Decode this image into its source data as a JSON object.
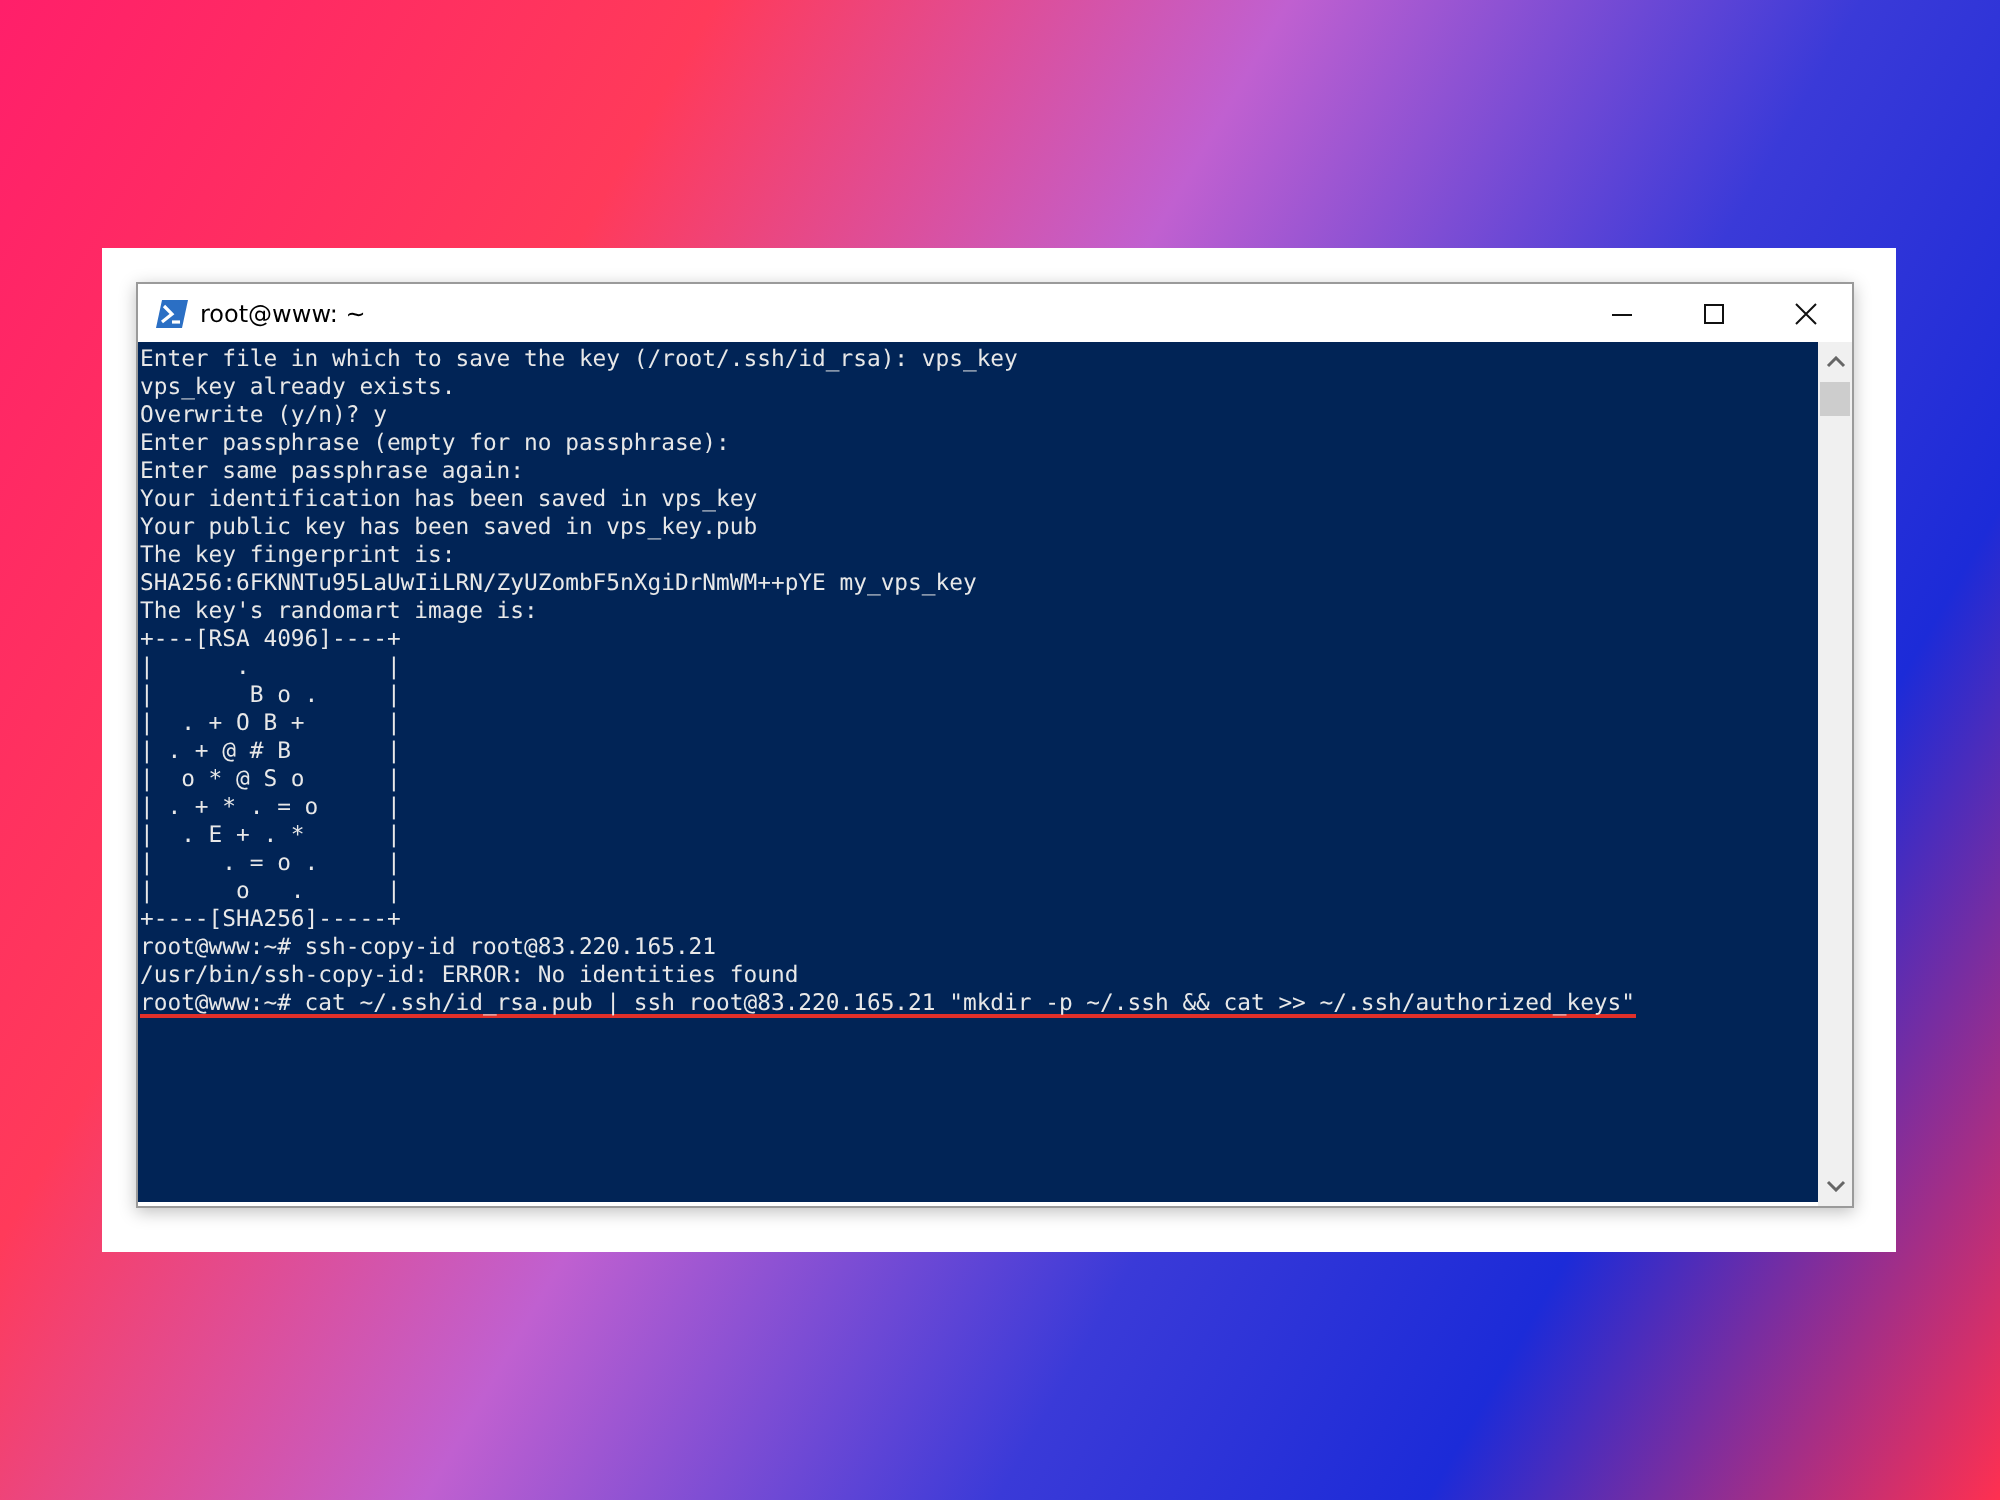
{
  "window": {
    "title": "root@www: ~"
  },
  "terminal": {
    "lines": [
      {
        "text": "Enter file in which to save the key (/root/.ssh/id_rsa): vps_key",
        "underlined": false
      },
      {
        "text": "vps_key already exists.",
        "underlined": false
      },
      {
        "text": "Overwrite (y/n)? y",
        "underlined": false
      },
      {
        "text": "Enter passphrase (empty for no passphrase):",
        "underlined": false
      },
      {
        "text": "Enter same passphrase again:",
        "underlined": false
      },
      {
        "text": "Your identification has been saved in vps_key",
        "underlined": false
      },
      {
        "text": "Your public key has been saved in vps_key.pub",
        "underlined": false
      },
      {
        "text": "The key fingerprint is:",
        "underlined": false
      },
      {
        "text": "SHA256:6FKNNTu95LaUwIiLRN/ZyUZombF5nXgiDrNmWM++pYE my_vps_key",
        "underlined": false
      },
      {
        "text": "The key's randomart image is:",
        "underlined": false
      },
      {
        "text": "+---[RSA 4096]----+",
        "underlined": false
      },
      {
        "text": "|      .          |",
        "underlined": false
      },
      {
        "text": "|       B o .     |",
        "underlined": false
      },
      {
        "text": "|  . + O B +      |",
        "underlined": false
      },
      {
        "text": "| . + @ # B       |",
        "underlined": false
      },
      {
        "text": "|  o * @ S o      |",
        "underlined": false
      },
      {
        "text": "| . + * . = o     |",
        "underlined": false
      },
      {
        "text": "|  . E + . *      |",
        "underlined": false
      },
      {
        "text": "|     . = o .     |",
        "underlined": false
      },
      {
        "text": "|      o   .      |",
        "underlined": false
      },
      {
        "text": "+----[SHA256]-----+",
        "underlined": false
      },
      {
        "text": "root@www:~# ssh-copy-id root@83.220.165.21",
        "underlined": false
      },
      {
        "text": "/usr/bin/ssh-copy-id: ERROR: No identities found",
        "underlined": false
      },
      {
        "text": "root@www:~# cat ~/.ssh/id_rsa.pub | ssh root@83.220.165.21 \"mkdir -p ~/.ssh && cat >> ~/.ssh/authorized_keys\"",
        "underlined": true
      }
    ]
  }
}
